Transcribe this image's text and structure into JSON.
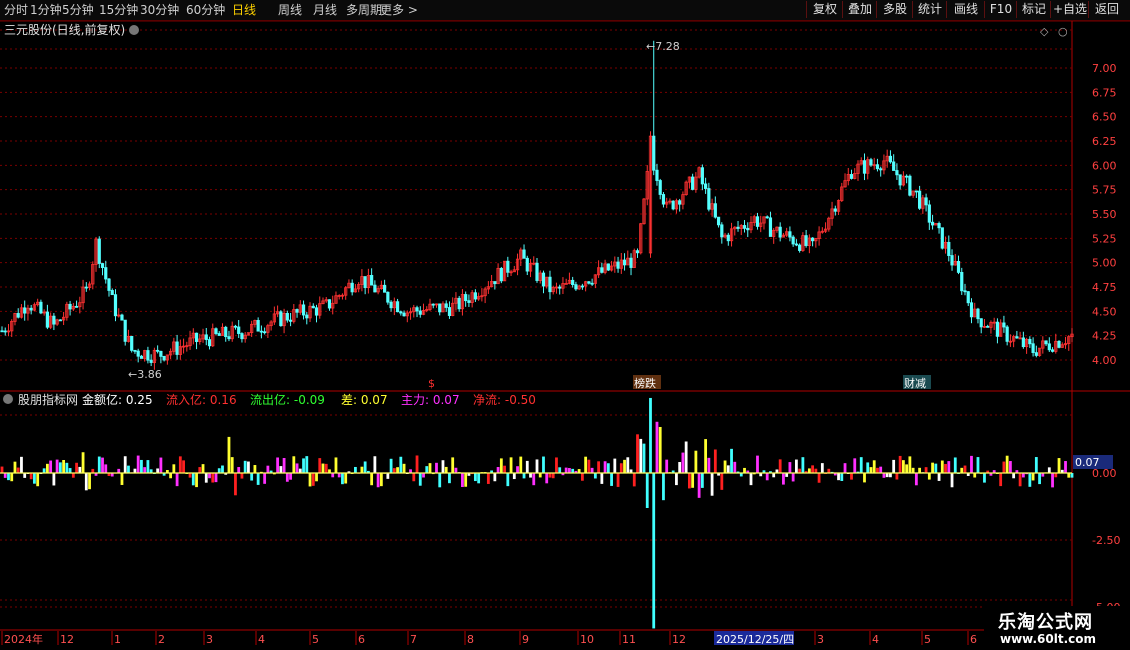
{
  "toolbar": {
    "periods": [
      "分时",
      "1分钟",
      "5分钟",
      "15分钟",
      "30分钟",
      "60分钟",
      "日线",
      "周线",
      "月线",
      "多周期",
      "更多 >"
    ],
    "active_period": "日线",
    "right_buttons": [
      "复权",
      "叠加",
      "多股",
      "统计",
      "画线",
      "F10",
      "标记",
      "+自选",
      "返回"
    ]
  },
  "main_chart": {
    "title": "三元股份(日线,前复权)",
    "high_label": "7.28",
    "low_label": "3.86",
    "event_labels": [
      {
        "text": "$",
        "color": "#ff3030"
      },
      {
        "text": "榜跌",
        "color": "#ffffff"
      },
      {
        "text": "财减",
        "color": "#ffffff"
      }
    ],
    "y_ticks": [
      "7.00",
      "6.75",
      "6.50",
      "6.25",
      "6.00",
      "5.75",
      "5.50",
      "5.25",
      "5.00",
      "4.75",
      "4.50",
      "4.25",
      "4.00"
    ]
  },
  "indicator": {
    "name": "股朋指标网",
    "fields": [
      {
        "label": "金额亿:",
        "value": "0.25",
        "color": "#ffffff"
      },
      {
        "label": "流入亿:",
        "value": "0.16",
        "color": "#ff3030"
      },
      {
        "label": "流出亿:",
        "value": "-0.09",
        "color": "#30ff30"
      },
      {
        "label": "差:",
        "value": "0.07",
        "color": "#ffff30"
      },
      {
        "label": "主力:",
        "value": "0.07",
        "color": "#ff30ff"
      },
      {
        "label": "净流:",
        "value": "-0.50",
        "color": "#ff3030"
      }
    ],
    "y_ticks": [
      "0.00",
      "-2.50",
      "-5.00"
    ],
    "current_value": "0.07"
  },
  "time_axis": {
    "labels": [
      "2024年",
      "12",
      "1",
      "2",
      "3",
      "4",
      "5",
      "6",
      "7",
      "8",
      "9",
      "10",
      "11",
      "12",
      "3",
      "4",
      "5",
      "6"
    ],
    "cursor_date": "2025/12/25/四"
  },
  "watermark": {
    "line1": "乐淘公式网",
    "line2": "www.60lt.com"
  },
  "colors": {
    "up": "#ff3232",
    "down": "#54ffff",
    "grid": "#7a0000",
    "magenta": "#ff30ff",
    "yellow": "#ffff30",
    "white": "#ffffff",
    "cyan": "#40ffff",
    "red": "#ff2020"
  }
}
